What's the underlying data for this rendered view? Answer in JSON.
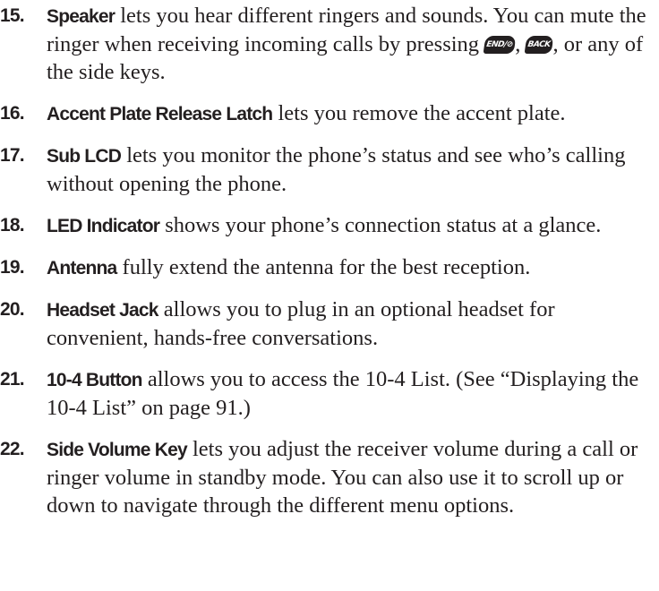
{
  "items": [
    {
      "num": "15.",
      "term": "Speaker",
      "text_a": " lets you hear different ringers and sounds. You can mute the ringer when receiving incoming calls by pressing ",
      "icon_end": "END/⊘",
      "sep": ", ",
      "icon_back": "BACK",
      "text_b": ", or any of the side keys."
    },
    {
      "num": "16.",
      "term": "Accent Plate Release Latch",
      "text": " lets you remove the accent plate."
    },
    {
      "num": "17.",
      "term": "Sub LCD",
      "text": " lets you monitor the phone’s status and see who’s calling without opening the phone."
    },
    {
      "num": "18.",
      "term": "LED Indicator",
      "text": " shows your phone’s connection status at a glance."
    },
    {
      "num": "19.",
      "term": "Antenna",
      "text": " fully extend the antenna for the best reception."
    },
    {
      "num": "20.",
      "term": "Headset Jack",
      "text": " allows you to plug in an optional headset for convenient, hands-free conversations."
    },
    {
      "num": "21.",
      "term": "10-4 Button",
      "text": " allows you to access the 10-4 List. (See “Displaying the 10-4 List” on page 91.)"
    },
    {
      "num": "22.",
      "term": "Side Volume Key",
      "text": " lets you adjust the receiver volume during a call or ringer volume in standby mode. You can also use it to scroll up or down to navigate through the different menu options."
    }
  ]
}
